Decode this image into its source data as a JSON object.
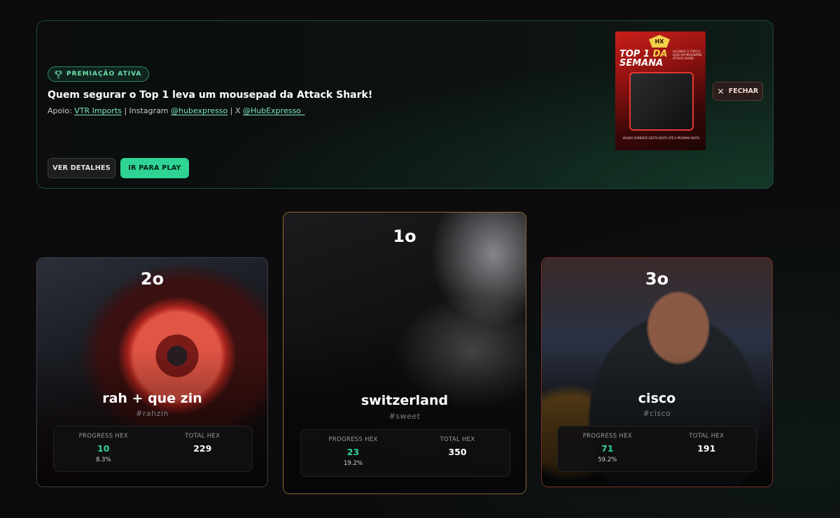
{
  "banner": {
    "badge_label": "PREMIAÇÃO ATIVA",
    "headline": "Quem segurar o Top 1 leva um mousepad da Attack Shark!",
    "support": {
      "prefix": "Apoio: ",
      "sponsor": "VTR Imports",
      "sep1": " | Instagram ",
      "instagram": "@hubexpresso",
      "sep2": " | X ",
      "x_handle": "@HubExpresso_"
    },
    "details_button": "VER DETALHES",
    "play_button": "IR PARA PLAY",
    "close_button": "FECHAR",
    "poster": {
      "logo": "HX",
      "title_line1": "TOP 1",
      "title_accent": "DA",
      "title_line2": "SEMANA",
      "side_text": "ALCANCE O TOPO E LEVE UM MOUSEPAD ATTACK SHARK",
      "footer": "VÁLIDO SOMENTE DESTA SEXTA ATÉ A PRÓXIMA SEXTA"
    }
  },
  "podium": [
    {
      "rank": "2o",
      "name": "rah + que zin",
      "tag": "#rahzin",
      "progress_label": "PROGRESS HEX",
      "progress_value": "10",
      "progress_pct": "8.3%",
      "total_label": "TOTAL HEX",
      "total_value": "229"
    },
    {
      "rank": "1o",
      "name": "switzerland",
      "tag": "#sweet",
      "progress_label": "PROGRESS HEX",
      "progress_value": "23",
      "progress_pct": "19.2%",
      "total_label": "TOTAL HEX",
      "total_value": "350"
    },
    {
      "rank": "3o",
      "name": "cisco",
      "tag": "#cisco",
      "progress_label": "PROGRESS HEX",
      "progress_value": "71",
      "progress_pct": "59.2%",
      "total_label": "TOTAL HEX",
      "total_value": "191"
    }
  ],
  "colors": {
    "accent_green": "#2fd394",
    "gold_border": "#8a6a2a",
    "bronze_border": "#7a2e22",
    "silver_border": "#3e3e44"
  },
  "icons": {
    "badge": "trophy-icon",
    "close": "close-icon"
  }
}
